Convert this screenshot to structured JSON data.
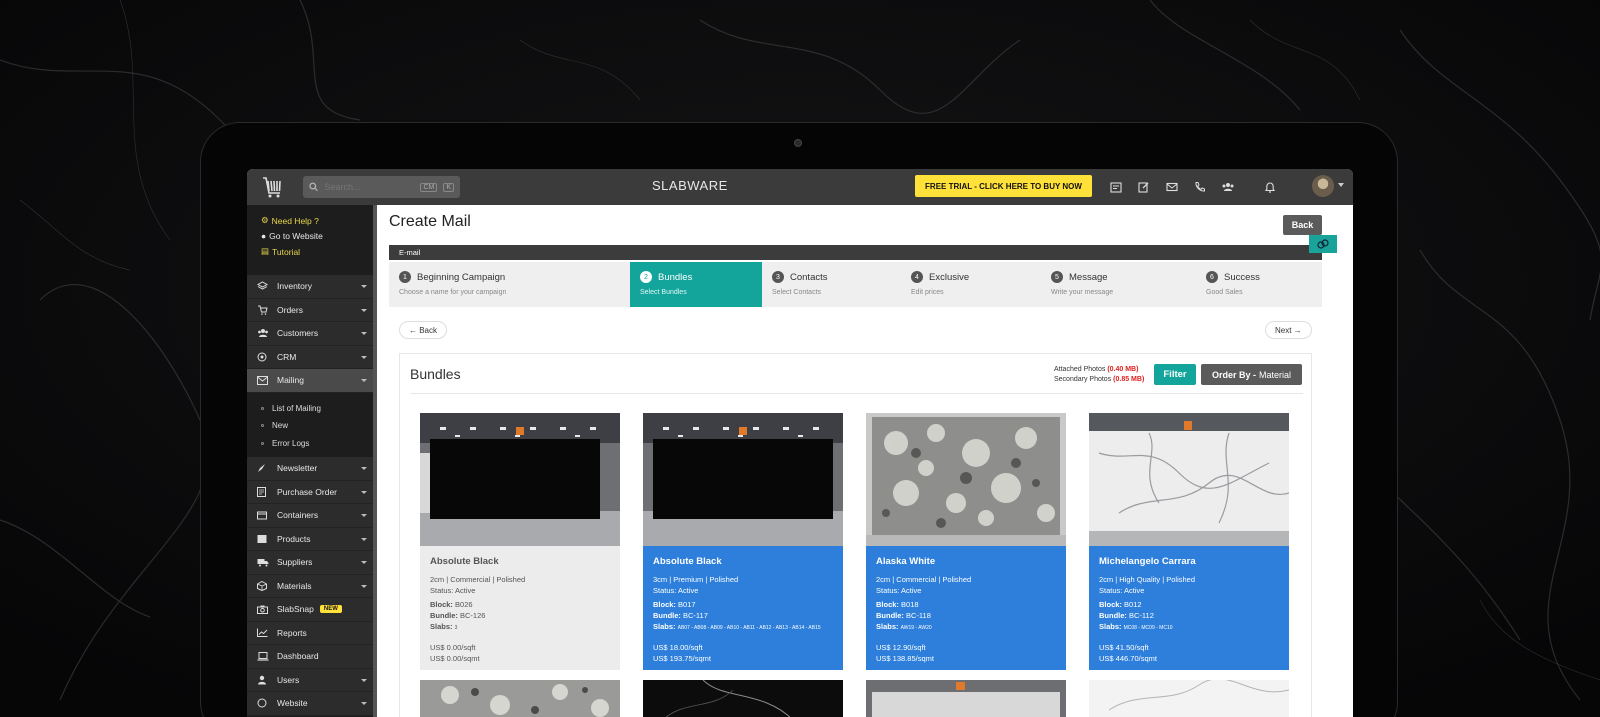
{
  "app": {
    "brand": "SLABWARE",
    "trial_button": "FREE TRIAL - CLICK HERE TO BUY NOW",
    "search_placeholder": "Search...",
    "search_kbd_1": "CM",
    "search_kbd_2": "K"
  },
  "sidebar": {
    "help": [
      {
        "label": "Need Help ?",
        "icon": "help-icon"
      },
      {
        "label": "Go to Website",
        "icon": "globe-icon"
      },
      {
        "label": "Tutorial",
        "icon": "tutorial-icon"
      }
    ],
    "items": [
      {
        "label": "Inventory",
        "icon": "layers-icon",
        "caret": true
      },
      {
        "label": "Orders",
        "icon": "cart-icon",
        "caret": true
      },
      {
        "label": "Customers",
        "icon": "users-icon",
        "caret": true
      },
      {
        "label": "CRM",
        "icon": "target-icon",
        "caret": true
      },
      {
        "label": "Mailing",
        "icon": "mail-icon",
        "caret": true,
        "active": true
      }
    ],
    "sub_items": [
      "List of Mailing",
      "New",
      "Error Logs"
    ],
    "items_after": [
      {
        "label": "Newsletter",
        "icon": "rocket-icon",
        "caret": true
      },
      {
        "label": "Purchase Order",
        "icon": "document-icon",
        "caret": true
      },
      {
        "label": "Containers",
        "icon": "box-icon",
        "caret": true
      },
      {
        "label": "Products",
        "icon": "product-icon",
        "caret": true
      },
      {
        "label": "Suppliers",
        "icon": "truck-icon",
        "caret": true
      },
      {
        "label": "Materials",
        "icon": "cube-icon",
        "caret": true
      },
      {
        "label": "SlabSnap",
        "icon": "camera-icon",
        "caret": false,
        "badge": "NEW"
      },
      {
        "label": "Reports",
        "icon": "chart-icon",
        "caret": false
      },
      {
        "label": "Dashboard",
        "icon": "laptop-icon",
        "caret": false
      },
      {
        "label": "Users",
        "icon": "user-icon",
        "caret": true
      },
      {
        "label": "Website",
        "icon": "web-icon",
        "caret": true
      }
    ]
  },
  "main": {
    "title": "Create Mail",
    "back_button": "Back",
    "email_bar": "E-mail",
    "steps": [
      {
        "num": "1",
        "title": "Beginning Campaign",
        "sub": "Choose a name for your campaign",
        "active": false
      },
      {
        "num": "2",
        "title": "Bundles",
        "sub": "Select Bundles",
        "active": true
      },
      {
        "num": "3",
        "title": "Contacts",
        "sub": "Select Contacts",
        "active": false
      },
      {
        "num": "4",
        "title": "Exclusive",
        "sub": "Edit prices",
        "active": false
      },
      {
        "num": "5",
        "title": "Message",
        "sub": "Write your message",
        "active": false
      },
      {
        "num": "6",
        "title": "Success",
        "sub": "Good Sales",
        "active": false
      }
    ],
    "nav_back": "← Back",
    "nav_next": "Next →",
    "bundles": {
      "title": "Bundles",
      "attached_label": "Attached Photos",
      "attached_size": "(0.40 MB)",
      "secondary_label": "Secondary Photos",
      "secondary_size": "(0.85 MB)",
      "filter_button": "Filter",
      "order_by_label": "Order By -",
      "order_by_value": "Material",
      "items": [
        {
          "name": "Absolute Black",
          "spec": "2cm | Commercial | Polished",
          "status": "Status: Active",
          "block": "B026",
          "bundle": "BC-126",
          "slabs": "3",
          "price_sqft": "US$ 0.00/sqft",
          "price_sqmt": "US$ 0.00/sqmt",
          "selected": false,
          "image": "black"
        },
        {
          "name": "Absolute Black",
          "spec": "3cm | Premium | Polished",
          "status": "Status: Active",
          "block": "B017",
          "bundle": "BC-117",
          "slabs": "AB07 - AB08 - AB09 - AB10 - AB11 - AB12 - AB13 - AB14 - AB15",
          "price_sqft": "US$ 18.00/sqft",
          "price_sqmt": "US$ 193.75/sqmt",
          "selected": true,
          "image": "black"
        },
        {
          "name": "Alaska White",
          "spec": "2cm | Commercial | Polished",
          "status": "Status: Active",
          "block": "B018",
          "bundle": "BC-118",
          "slabs": "AW19 - AW20",
          "price_sqft": "US$ 12.90/sqft",
          "price_sqmt": "US$ 138.85/sqmt",
          "selected": true,
          "image": "granite"
        },
        {
          "name": "Michelangelo Carrara",
          "spec": "2cm | High Quality | Polished",
          "status": "Status: Active",
          "block": "B012",
          "bundle": "BC-112",
          "slabs": "MC08 - MC09 - MC10",
          "price_sqft": "US$ 41.50/sqft",
          "price_sqmt": "US$ 446.70/sqmt",
          "selected": true,
          "image": "marble"
        }
      ],
      "labels": {
        "block": "Block:",
        "bundle": "Bundle:",
        "slabs": "Slabs:"
      }
    }
  },
  "colors": {
    "teal": "#13a59c",
    "blue": "#2d7fdb",
    "yellow": "#ffe13a",
    "sidebar": "#1d1d1d",
    "topbar": "#3b3b3b"
  }
}
